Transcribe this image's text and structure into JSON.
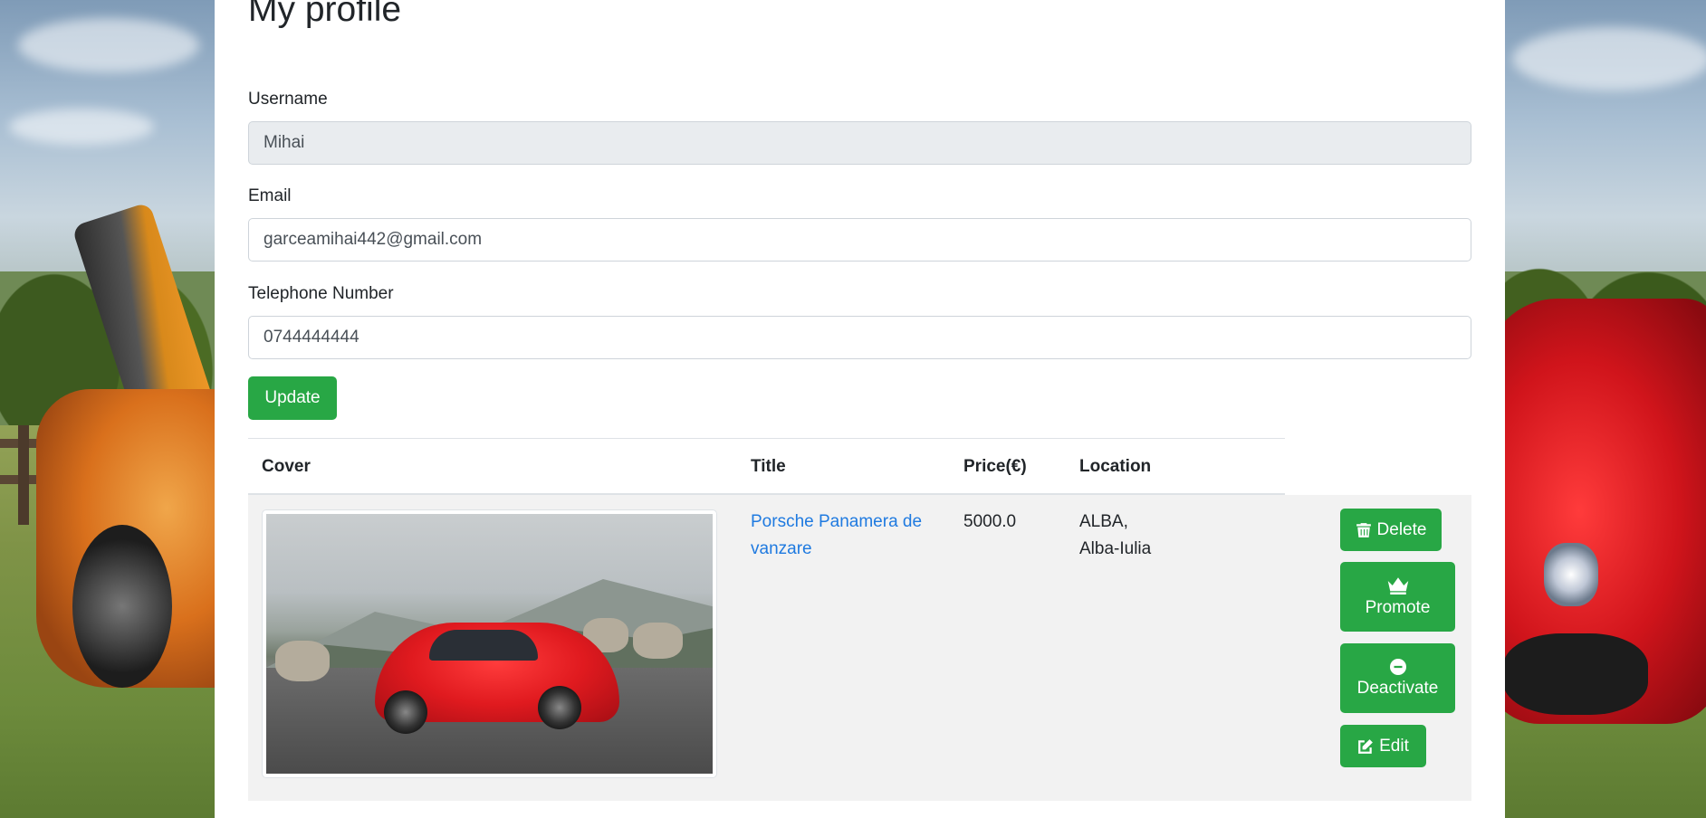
{
  "profile": {
    "title": "My profile",
    "username_label": "Username",
    "username_value": "Mihai",
    "email_label": "Email",
    "email_value": "garceamihai442@gmail.com",
    "phone_label": "Telephone Number",
    "phone_value": "0744444444",
    "update_label": "Update"
  },
  "table": {
    "headers": [
      "Cover",
      "Title",
      "Price(€)",
      "Location"
    ],
    "rows": [
      {
        "title": "Porsche Panamera de vanzare",
        "price": "5000.0",
        "location_line1": "ALBA,",
        "location_line2": "Alba-Iulia",
        "actions": {
          "delete": "Delete",
          "promote": "Promote",
          "deactivate": "Deactivate",
          "edit": "Edit"
        }
      }
    ]
  },
  "icons": {
    "delete": "trash-icon",
    "promote": "crown-icon",
    "deactivate": "minus-circle-icon",
    "edit": "edit-icon"
  },
  "colors": {
    "primary_button": "#28a745",
    "link": "#1f7ae0",
    "readonly_input": "#e9ecef",
    "row_background": "#f2f2f2"
  }
}
